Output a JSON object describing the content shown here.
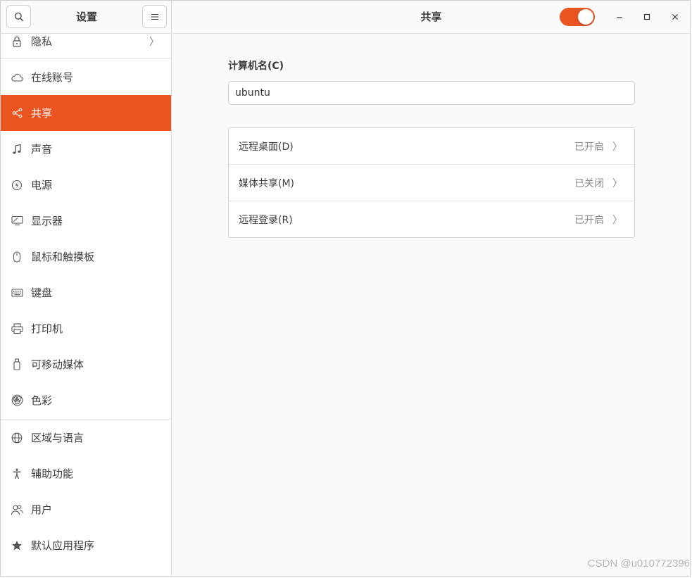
{
  "sidebar": {
    "title": "设置",
    "search_icon": "search-icon",
    "menu_icon": "hamburger-menu-icon",
    "items": [
      {
        "label": "隐私",
        "icon": "lock-icon",
        "has_chevron": true
      },
      {
        "label": "在线账号",
        "icon": "cloud-icon"
      },
      {
        "label": "共享",
        "icon": "share-icon",
        "active": true
      },
      {
        "label": "声音",
        "icon": "music-note-icon"
      },
      {
        "label": "电源",
        "icon": "power-icon"
      },
      {
        "label": "显示器",
        "icon": "display-icon"
      },
      {
        "label": "鼠标和触摸板",
        "icon": "mouse-icon"
      },
      {
        "label": "键盘",
        "icon": "keyboard-icon"
      },
      {
        "label": "打印机",
        "icon": "printer-icon"
      },
      {
        "label": "可移动媒体",
        "icon": "usb-drive-icon"
      },
      {
        "label": "色彩",
        "icon": "color-icon"
      },
      {
        "label": "区域与语言",
        "icon": "globe-icon"
      },
      {
        "label": "辅助功能",
        "icon": "accessibility-icon"
      },
      {
        "label": "用户",
        "icon": "users-icon"
      },
      {
        "label": "默认应用程序",
        "icon": "star-icon"
      }
    ]
  },
  "header": {
    "title": "共享",
    "sharing_toggle_on": true,
    "accent_color": "#e95420"
  },
  "main": {
    "computer_name_label": "计算机名(C)",
    "computer_name_value": "ubuntu",
    "rows": [
      {
        "label": "远程桌面(D)",
        "status": "已开启"
      },
      {
        "label": "媒体共享(M)",
        "status": "已关闭"
      },
      {
        "label": "远程登录(R)",
        "status": "已开启"
      }
    ]
  },
  "watermark": "CSDN @u010772396"
}
